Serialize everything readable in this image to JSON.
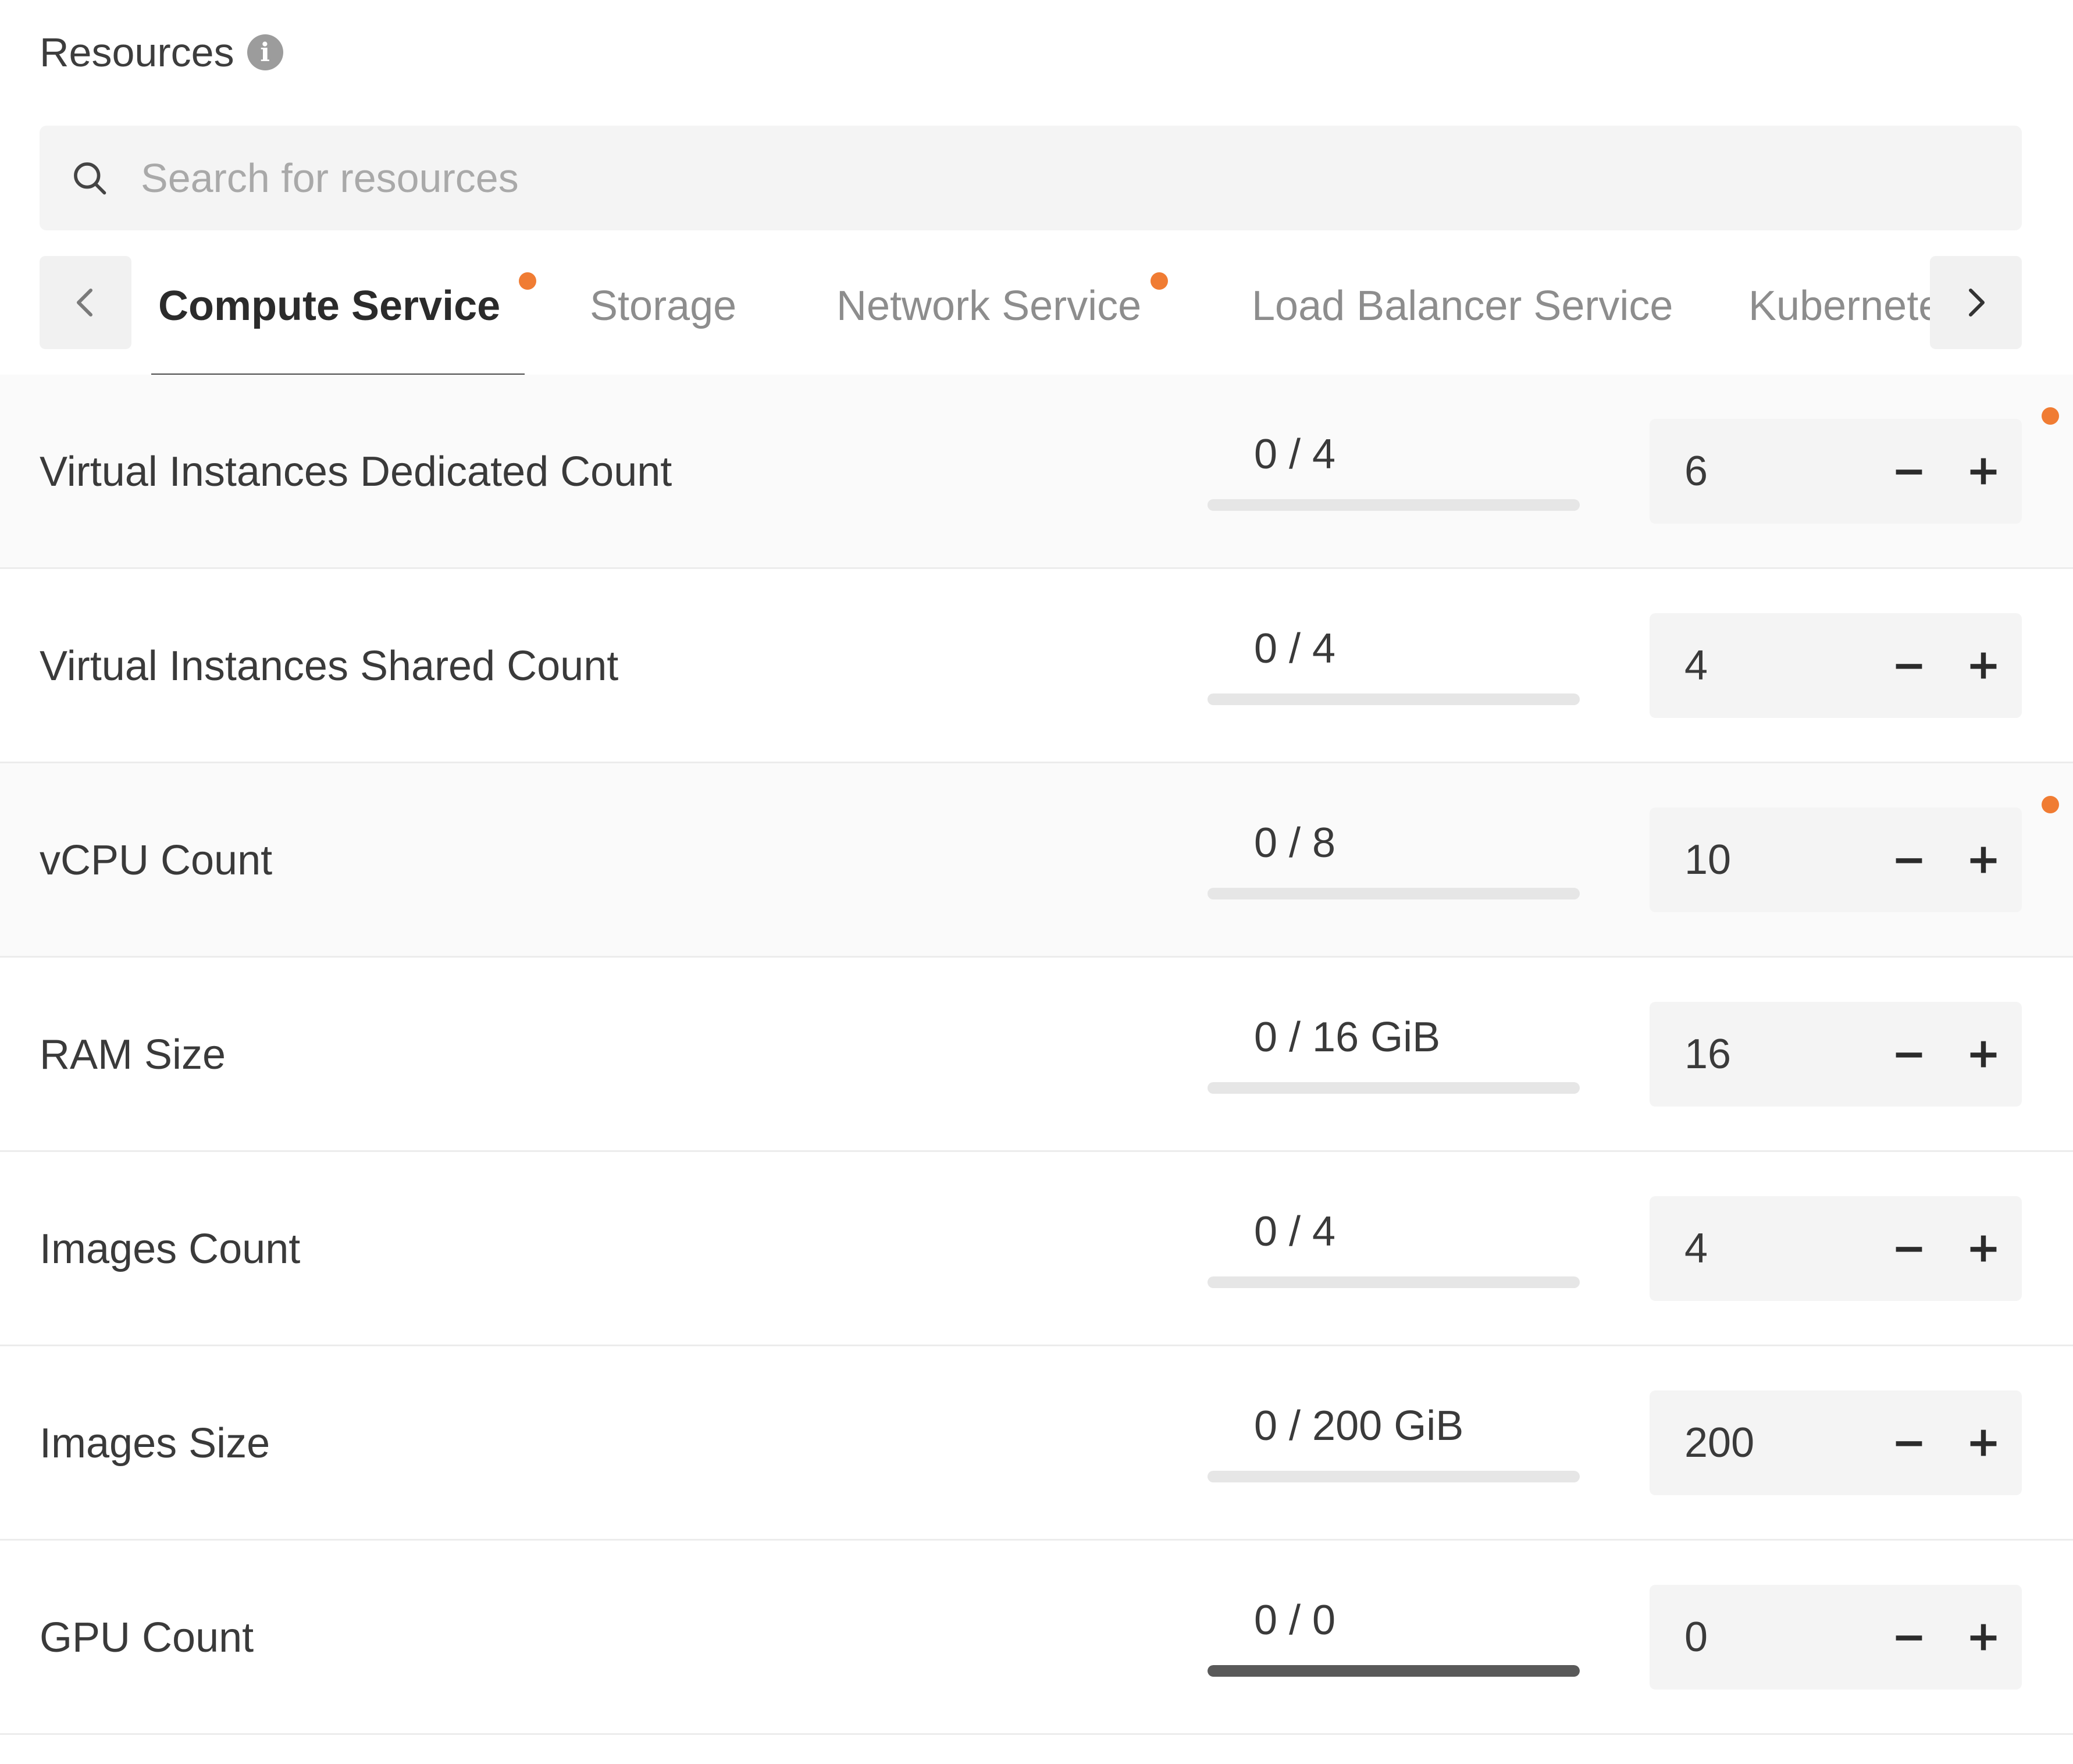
{
  "header": {
    "title": "Resources",
    "info_icon": "info-icon"
  },
  "search": {
    "placeholder": "Search for resources",
    "value": ""
  },
  "tabs": [
    {
      "label": "Compute Service",
      "active": true,
      "modified": true
    },
    {
      "label": "Storage",
      "active": false,
      "modified": false
    },
    {
      "label": "Network Service",
      "active": false,
      "modified": true
    },
    {
      "label": "Load Balancer Service",
      "active": false,
      "modified": false
    },
    {
      "label": "Kubernetes",
      "active": false,
      "modified": false
    }
  ],
  "navigation": {
    "prev_icon": "chevron-left-icon",
    "next_icon": "chevron-right-icon"
  },
  "resources": [
    {
      "label": "Virtual Instances Dedicated Count",
      "usage": "0 / 4",
      "usage_fraction": 0,
      "value": "6",
      "modified": true
    },
    {
      "label": "Virtual Instances Shared Count",
      "usage": "0 / 4",
      "usage_fraction": 0,
      "value": "4",
      "modified": false
    },
    {
      "label": "vCPU Count",
      "usage": "0 / 8",
      "usage_fraction": 0,
      "value": "10",
      "modified": true
    },
    {
      "label": "RAM Size",
      "usage": "0 / 16 GiB",
      "usage_fraction": 0,
      "value": "16",
      "modified": false
    },
    {
      "label": "Images Count",
      "usage": "0 / 4",
      "usage_fraction": 0,
      "value": "4",
      "modified": false
    },
    {
      "label": "Images Size",
      "usage": "0 / 200 GiB",
      "usage_fraction": 0,
      "value": "200",
      "modified": false
    },
    {
      "label": "GPU Count",
      "usage": "0 / 0",
      "usage_fraction": 1,
      "value": "0",
      "modified": false
    }
  ],
  "colors": {
    "accent_dot": "#f07c33",
    "usage_fill": "#595959",
    "usage_track": "#e6e6e6",
    "modified_row_bg": "#fafafa"
  }
}
